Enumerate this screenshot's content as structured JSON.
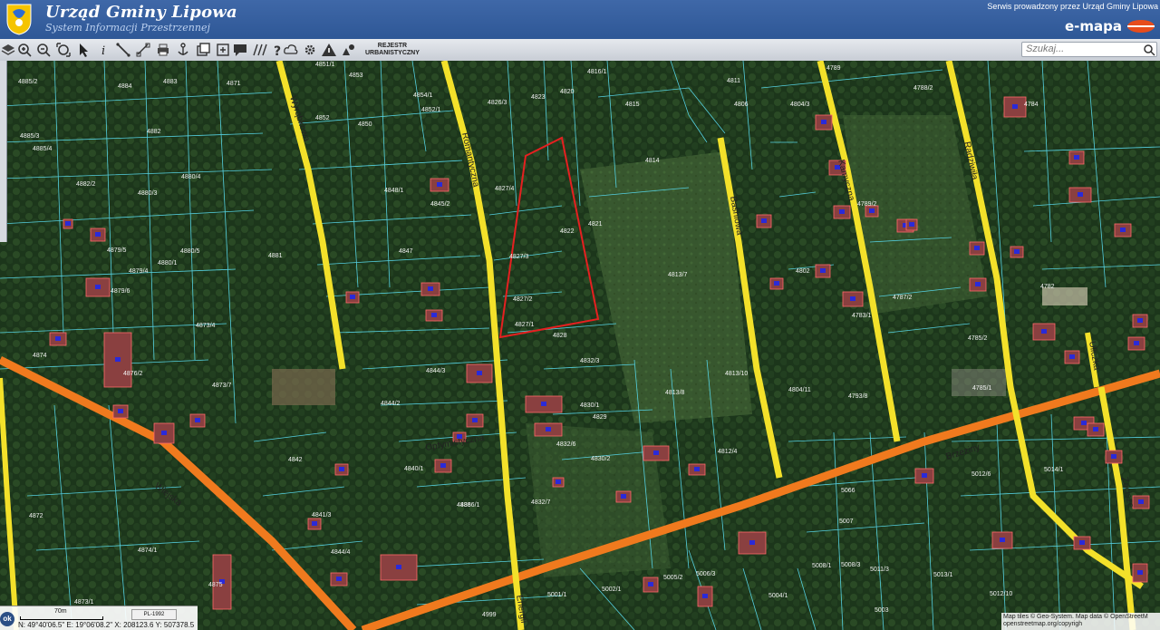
{
  "header": {
    "title": "Urząd Gminy Lipowa",
    "subtitle": "System Informacji Przestrzennej",
    "provider": "Serwis prowadzony przez Urząd Gminy Lipowa",
    "brand": "e-mapa"
  },
  "toolbar": {
    "tools": [
      "layers-icon",
      "zoom-in-icon",
      "zoom-out-icon",
      "zoom-extent-icon",
      "pointer-icon",
      "info-icon",
      "measure-line-icon",
      "measure-link-icon",
      "print-icon",
      "anchor-icon",
      "export-icon",
      "comment-icon",
      "hatch-icon",
      "help-icon",
      "cloud-icon",
      "settings-icon",
      "warning-icon",
      "shapes-icon"
    ],
    "rejestr_line1": "REJESTR",
    "rejestr_line2": "URBANISTYCZNY",
    "search_placeholder": "Szukaj..."
  },
  "map": {
    "streets": [
      {
        "name": "Wyrąbkowa"
      },
      {
        "name": "Romantyczna"
      },
      {
        "name": "Baśniowa"
      },
      {
        "name": "Kamyczna"
      },
      {
        "name": "Radziwiła"
      },
      {
        "name": "Wiejska"
      },
      {
        "name": "Optymistyczna"
      },
      {
        "name": "Brzeziny"
      },
      {
        "name": "Energii"
      },
      {
        "name": "Uliczka"
      },
      {
        "name": "Zacisze"
      }
    ],
    "parcels": [
      {
        "label": "4885/2"
      },
      {
        "label": "4884"
      },
      {
        "label": "4883"
      },
      {
        "label": "4871"
      },
      {
        "label": "4851/1"
      },
      {
        "label": "4853"
      },
      {
        "label": "4852"
      },
      {
        "label": "4850"
      },
      {
        "label": "4854/1"
      },
      {
        "label": "4852/1"
      },
      {
        "label": "4826/3"
      },
      {
        "label": "4823"
      },
      {
        "label": "4820"
      },
      {
        "label": "4816/1"
      },
      {
        "label": "4815"
      },
      {
        "label": "4814"
      },
      {
        "label": "4811"
      },
      {
        "label": "4806"
      },
      {
        "label": "4804/3"
      },
      {
        "label": "4789"
      },
      {
        "label": "4788/2"
      },
      {
        "label": "4784"
      },
      {
        "label": "4885/3"
      },
      {
        "label": "4882"
      },
      {
        "label": "4885/4"
      },
      {
        "label": "4882/2"
      },
      {
        "label": "4880/3"
      },
      {
        "label": "4880/4"
      },
      {
        "label": "4848/1"
      },
      {
        "label": "4845/2"
      },
      {
        "label": "4827/4"
      },
      {
        "label": "4822"
      },
      {
        "label": "4821"
      },
      {
        "label": "4813/7"
      },
      {
        "label": "4802"
      },
      {
        "label": "4789/2"
      },
      {
        "label": "4787/2"
      },
      {
        "label": "4782"
      },
      {
        "label": "4879/5"
      },
      {
        "label": "4879/6"
      },
      {
        "label": "4879/4"
      },
      {
        "label": "4880/1"
      },
      {
        "label": "4880/5"
      },
      {
        "label": "4881"
      },
      {
        "label": "4847"
      },
      {
        "label": "4827/3"
      },
      {
        "label": "4827/2"
      },
      {
        "label": "4827/1"
      },
      {
        "label": "4828"
      },
      {
        "label": "4783/1"
      },
      {
        "label": "4785/2"
      },
      {
        "label": "4785/1"
      },
      {
        "label": "4876/2"
      },
      {
        "label": "4874"
      },
      {
        "label": "4873/4"
      },
      {
        "label": "4873/7"
      },
      {
        "label": "4844/3"
      },
      {
        "label": "4844/2"
      },
      {
        "label": "4832/3"
      },
      {
        "label": "4830/1"
      },
      {
        "label": "4813/8"
      },
      {
        "label": "4813/10"
      },
      {
        "label": "4804/11"
      },
      {
        "label": "4793/8"
      },
      {
        "label": "4842"
      },
      {
        "label": "4840/1"
      },
      {
        "label": "4836"
      },
      {
        "label": "4832/7"
      },
      {
        "label": "4830/2"
      },
      {
        "label": "4812/4"
      },
      {
        "label": "5066"
      },
      {
        "label": "5012/6"
      },
      {
        "label": "5014/1"
      },
      {
        "label": "4874/1"
      },
      {
        "label": "4875"
      },
      {
        "label": "4841/3"
      },
      {
        "label": "4844/4"
      },
      {
        "label": "4999"
      },
      {
        "label": "5001/1"
      },
      {
        "label": "5002/1"
      },
      {
        "label": "5005/2"
      },
      {
        "label": "5006/3"
      },
      {
        "label": "5008/1"
      },
      {
        "label": "5011/3"
      },
      {
        "label": "5013/1"
      },
      {
        "label": "4873/1"
      },
      {
        "label": "4872"
      },
      {
        "label": "5004/1"
      },
      {
        "label": "5003"
      },
      {
        "label": "5012/10"
      },
      {
        "label": "4829"
      },
      {
        "label": "4832/6"
      },
      {
        "label": "4836/1"
      },
      {
        "label": "5007"
      },
      {
        "label": "5008/3"
      }
    ],
    "highlighted_parcel": "4822"
  },
  "status": {
    "ok": "ok",
    "scale": "70m",
    "crs": "PL-1992",
    "coords": "N: 49°40'06.5\"  E: 19°06'08.2\"  X: 208123.6  Y: 507378.5"
  },
  "attribution": {
    "line1": "Map tiles © Geo-System. Map data © OpenStreetM",
    "line2": "openstreetmap.org/copyrigh"
  },
  "colors": {
    "road_yellow": "#f3e12a",
    "road_orange": "#f07a1e",
    "parcel_line": "#55d0e0",
    "highlight": "#e52020",
    "header_blue": "#2e5796"
  }
}
